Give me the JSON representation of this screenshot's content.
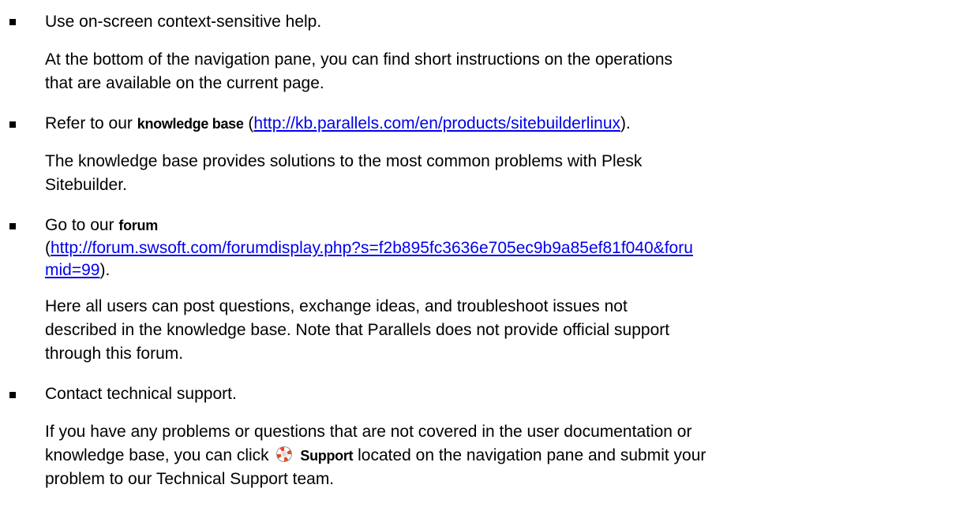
{
  "items": [
    {
      "lead": "Use on-screen context-sensitive help.",
      "description_lines": [
        "At the bottom of the navigation pane, you can find short instructions on the operations",
        "that are available on the current page."
      ]
    },
    {
      "lead_prefix": "Refer to our",
      "lead_bold": "knowledge base",
      "lead_open": "(",
      "lead_link": "http://kb.parallels.com/en/products/sitebuilderlinux",
      "lead_close": ").",
      "description_lines": [
        "The knowledge base provides solutions to the most common problems with Plesk",
        "Sitebuilder."
      ]
    },
    {
      "lead_prefix": "Go to our",
      "lead_bold": "forum",
      "lead_open": "(",
      "lead_link_line1": "http://forum.swsoft.com/forumdisplay.php?s=f2b895fc3636e705ec9b9a85ef81f040&foru",
      "lead_link_line2": "mid=99",
      "lead_close": ").",
      "description_lines": [
        "Here all users can post questions, exchange ideas, and troubleshoot issues not",
        "described in the knowledge base. Note that Parallels does not provide official support",
        "through this forum."
      ]
    },
    {
      "lead": "Contact technical support.",
      "description_line1": "If you have any problems or questions that are not covered in the user documentation or",
      "description_line2_prefix": "knowledge base, you can click",
      "description_line2_bold": "Support",
      "description_line2_suffix": "located on the navigation pane and submit your",
      "description_line3": "problem to our Technical Support team.",
      "icon": "lifebuoy-icon"
    }
  ],
  "colors": {
    "text": "#000000",
    "link": "#0000ee",
    "icon_red": "#e8462a",
    "icon_white": "#ffffff",
    "icon_grey": "#9a9a9a"
  }
}
